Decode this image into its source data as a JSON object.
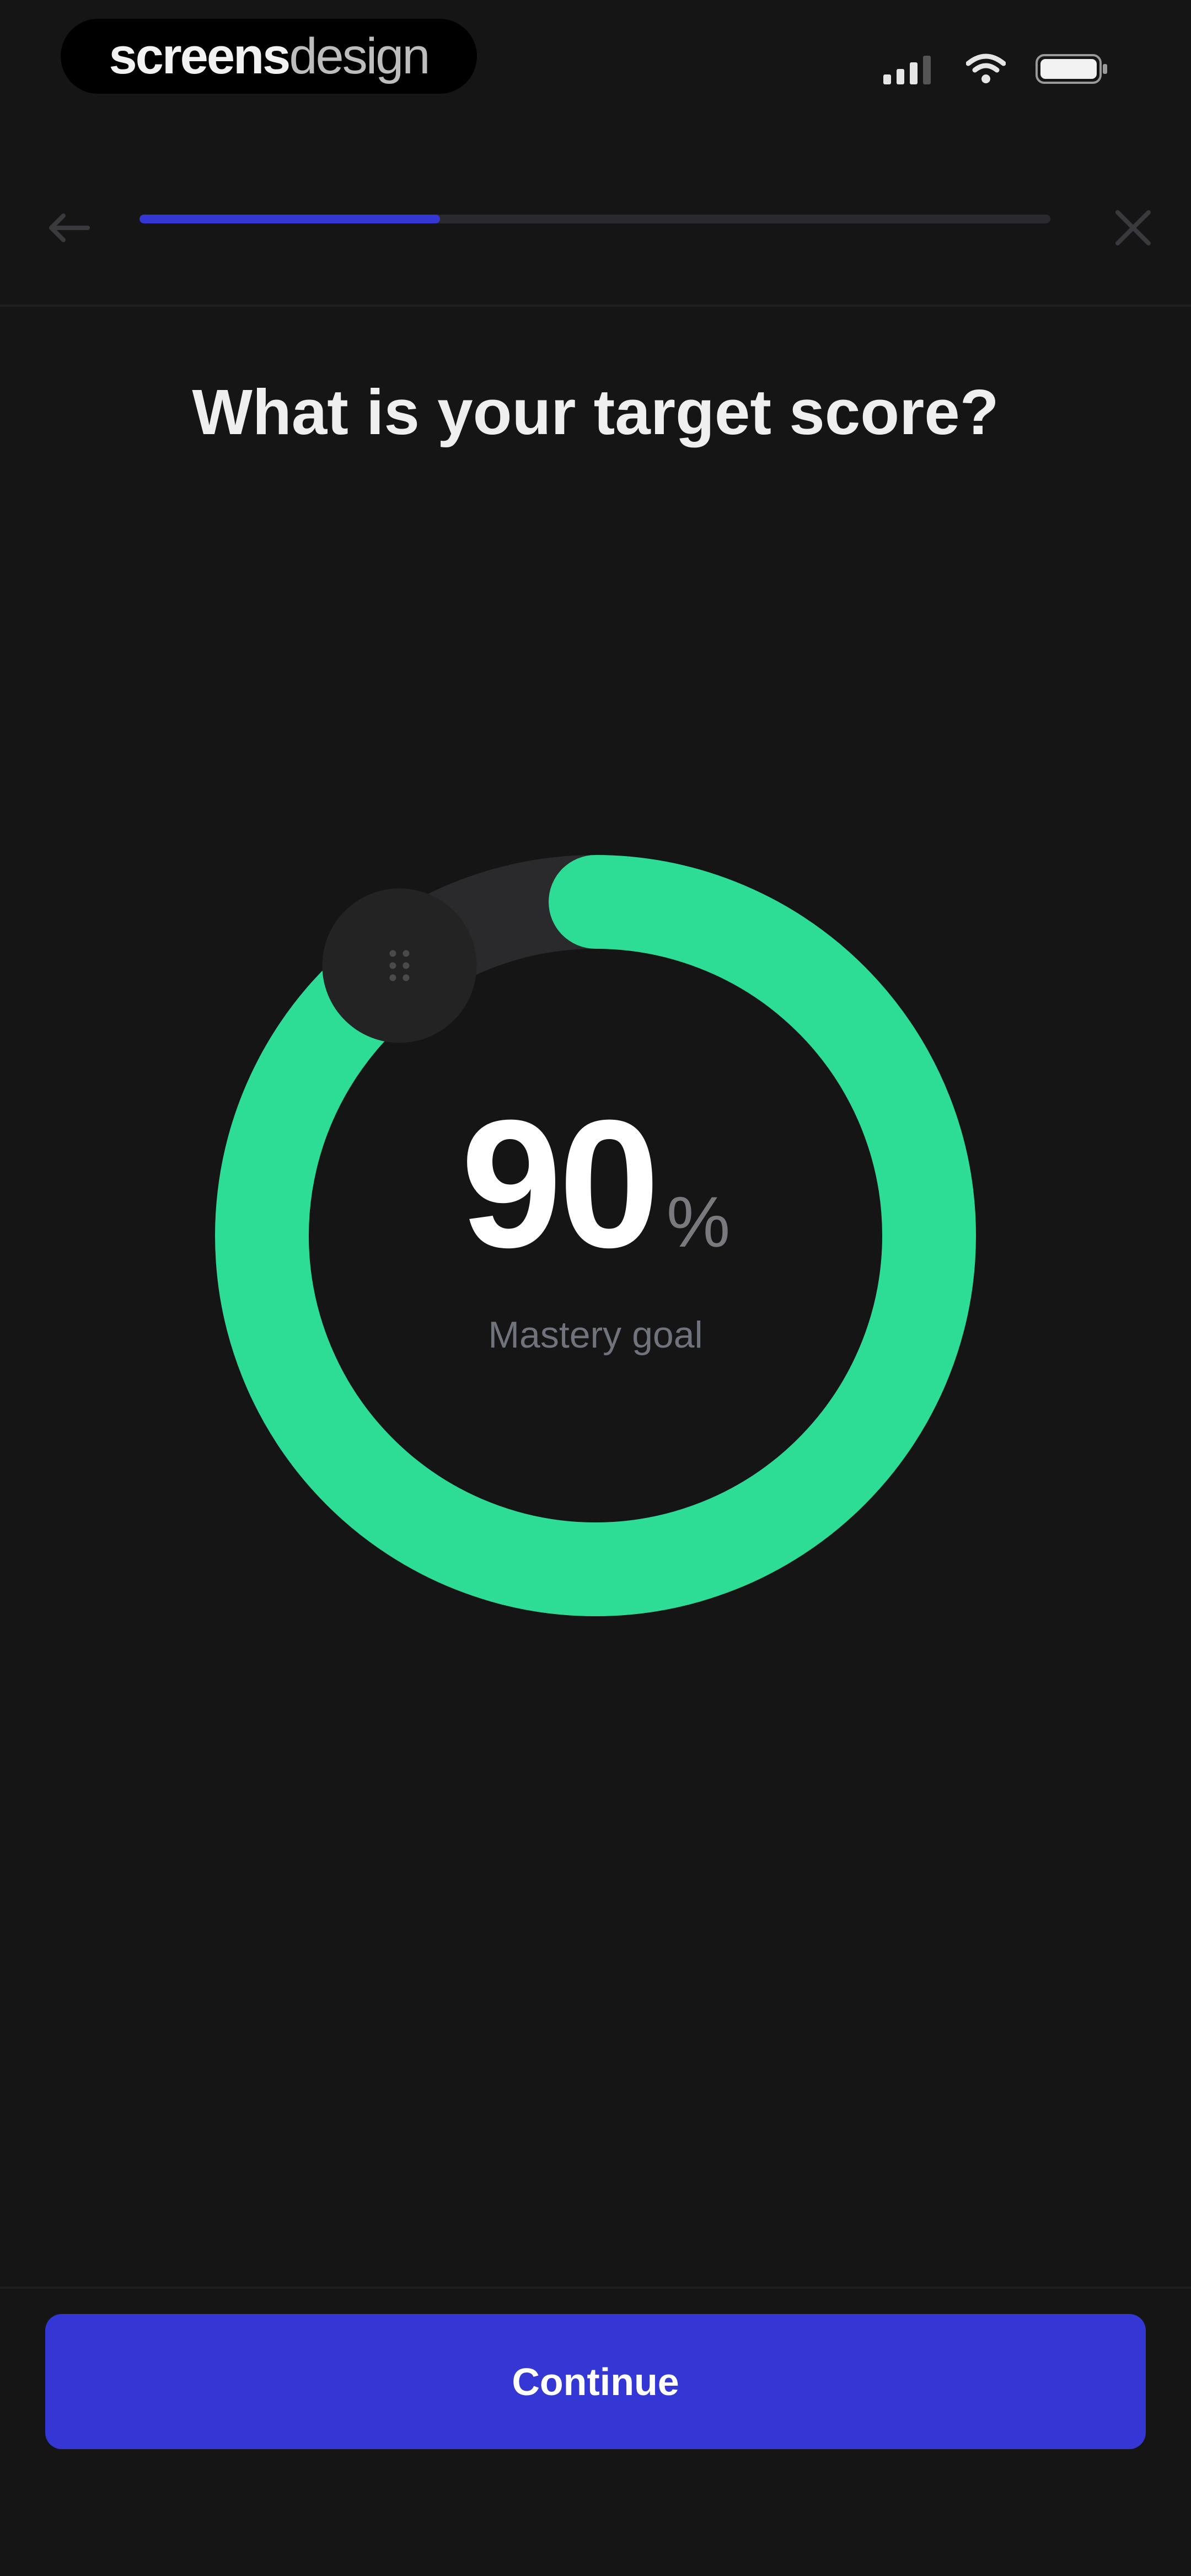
{
  "status_bar": {
    "brand_bold": "screens",
    "brand_light": "design",
    "icons": [
      "signal-icon",
      "wifi-icon",
      "battery-icon"
    ]
  },
  "nav": {
    "back_icon": "arrow-left-icon",
    "close_icon": "close-icon",
    "progress_fraction": 0.33
  },
  "title": "What is your target score?",
  "gauge": {
    "value": "90",
    "unit": "%",
    "caption": "Mastery goal",
    "fraction": 0.9,
    "handle_icon": "drag-handle-icon"
  },
  "continue_label": "Continue",
  "colors": {
    "background": "#151516",
    "accent": "#3437d4",
    "gauge_fill": "#2edd95",
    "gauge_track": "#2a2a2c"
  }
}
